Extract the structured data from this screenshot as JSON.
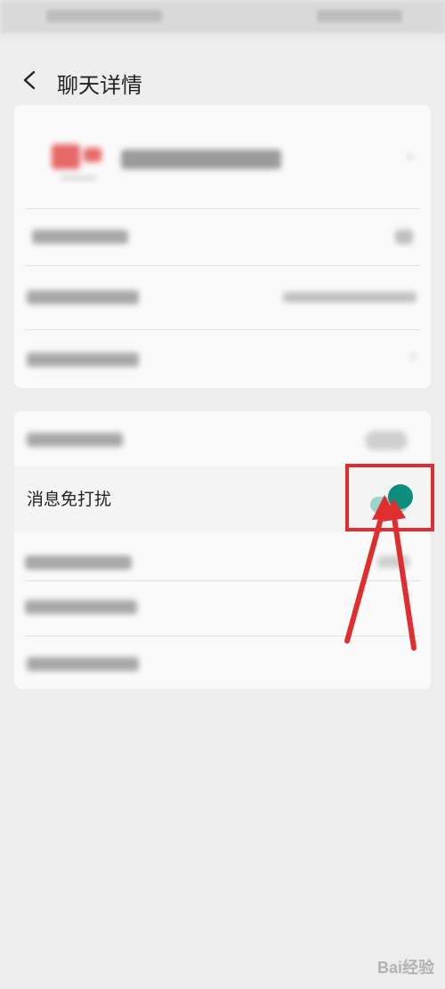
{
  "header": {
    "title": "聊天详情"
  },
  "settings": {
    "dnd_label": "消息免打扰",
    "dnd_enabled": true
  },
  "colors": {
    "toggle_on": "#0d8e7c",
    "toggle_track": "#9cd5cc",
    "highlight": "#e02d2d"
  },
  "watermark": {
    "text": "Bai经验"
  }
}
